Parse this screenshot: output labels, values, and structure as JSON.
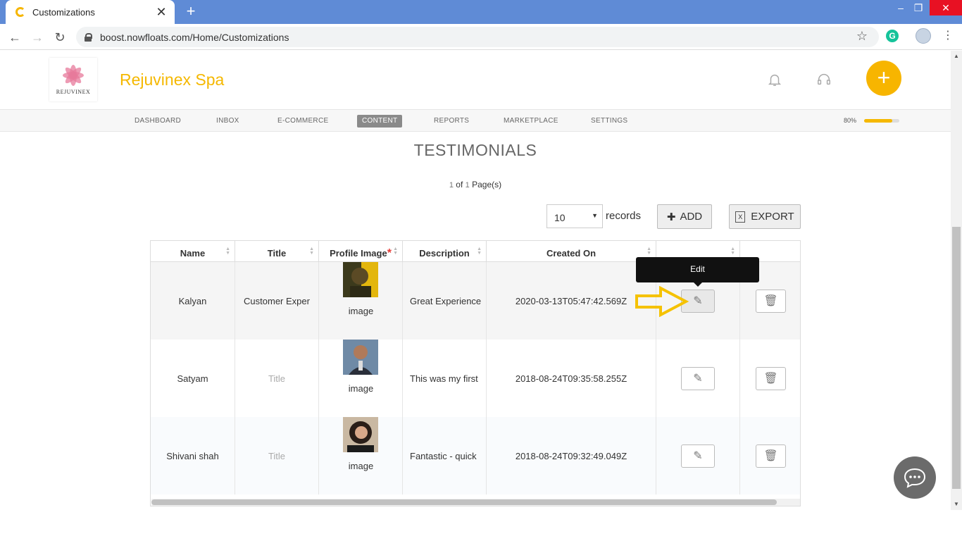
{
  "browser": {
    "tab_title": "Customizations",
    "url": "boost.nowfloats.com/Home/Customizations",
    "new_tab_icon": "plus-icon",
    "extension_letter": "G",
    "minimize_glyph": "–",
    "restore_glyph": "❐",
    "close_glyph": "✕"
  },
  "header": {
    "logo_text": "REJUVINEX",
    "brand_name": "Rejuvinex Spa",
    "fab_glyph": "+",
    "accent_color": "#f5b800"
  },
  "nav": {
    "items": [
      "DASHBOARD",
      "INBOX",
      "E-COMMERCE",
      "CONTENT",
      "REPORTS",
      "MARKETPLACE",
      "SETTINGS"
    ],
    "active": "CONTENT",
    "progress_label": "80%",
    "progress_value": 0.8
  },
  "section": {
    "title": "TESTIMONIALS",
    "pager_current": "1",
    "pager_of": " of ",
    "pager_total": "1",
    "pager_suffix": " Page(s)"
  },
  "controls": {
    "records_value": "10",
    "records_label": "records",
    "add_label": "ADD",
    "export_label": "EXPORT"
  },
  "table": {
    "columns": [
      "Name",
      "Title",
      "Profile Image",
      "Description",
      "Created On",
      "",
      ""
    ],
    "required_marker": "*",
    "rows": [
      {
        "name": "Kalyan",
        "title": "Customer Exper",
        "title_placeholder": false,
        "image_caption": "image",
        "description": "Great Experience",
        "created_on": "2020-03-13T05:47:42.569Z"
      },
      {
        "name": "Satyam",
        "title": "Title",
        "title_placeholder": true,
        "image_caption": "image",
        "description": "This was my first",
        "created_on": "2018-08-24T09:35:58.255Z"
      },
      {
        "name": "Shivani shah",
        "title": "Title",
        "title_placeholder": true,
        "image_caption": "image",
        "description": "Fantastic - quick",
        "created_on": "2018-08-24T09:32:49.049Z"
      }
    ]
  },
  "tooltip": {
    "text": "Edit"
  }
}
